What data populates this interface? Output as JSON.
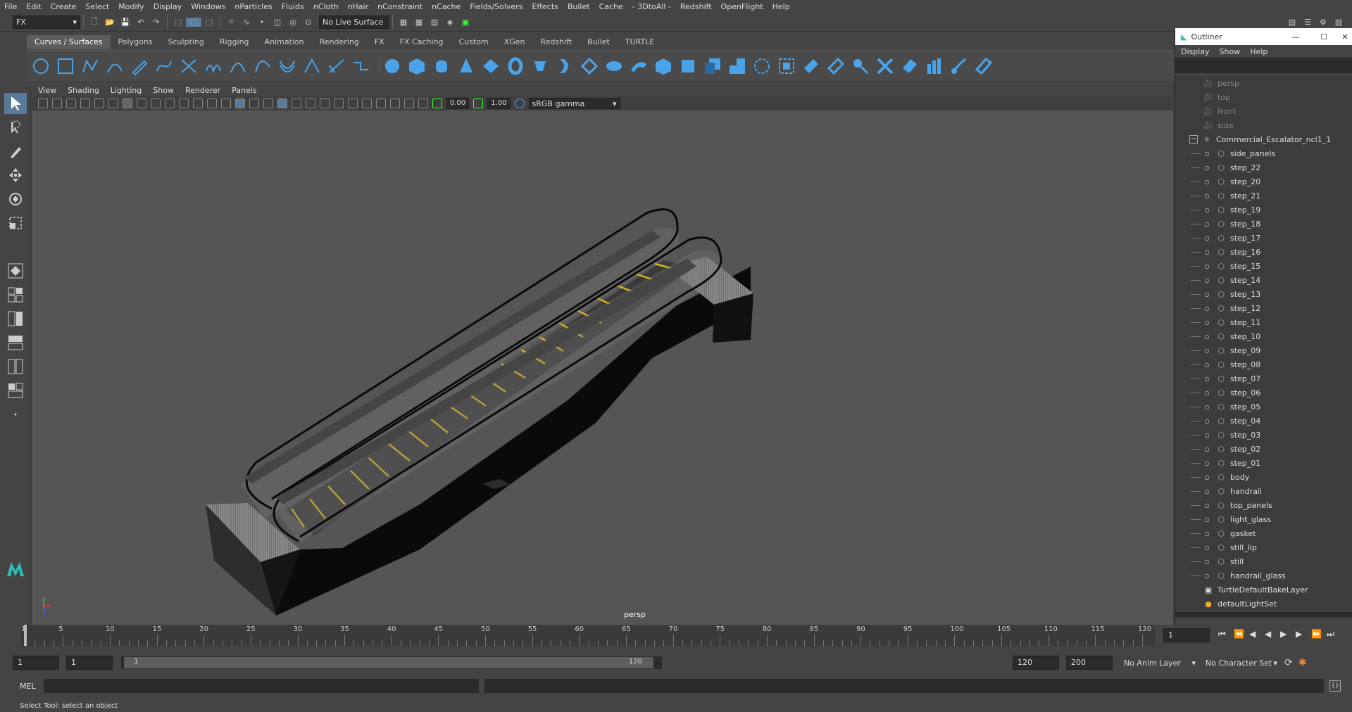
{
  "menubar": [
    "File",
    "Edit",
    "Create",
    "Select",
    "Modify",
    "Display",
    "Windows",
    "nParticles",
    "Fluids",
    "nCloth",
    "nHair",
    "nConstraint",
    "nCache",
    "Fields/Solvers",
    "Effects",
    "Bullet",
    "Cache",
    "- 3DtoAll -",
    "Redshift",
    "OpenFlight",
    "Help"
  ],
  "status": {
    "mode": "FX",
    "live_surface": "No Live Surface"
  },
  "shelf_tabs": [
    "Curves / Surfaces",
    "Polygons",
    "Sculpting",
    "Rigging",
    "Animation",
    "Rendering",
    "FX",
    "FX Caching",
    "Custom",
    "XGen",
    "Redshift",
    "Bullet",
    "TURTLE"
  ],
  "panel_menu": [
    "View",
    "Shading",
    "Lighting",
    "Show",
    "Renderer",
    "Panels"
  ],
  "panel_toolbar": {
    "exposure": "0.00",
    "gamma": "1.00",
    "color_space": "sRGB gamma"
  },
  "viewport": {
    "camera_label": "persp"
  },
  "outliner": {
    "title": "Outliner",
    "menu": [
      "Display",
      "Show",
      "Help"
    ],
    "cameras": [
      "persp",
      "top",
      "front",
      "side"
    ],
    "group": "Commercial_Escalator_ncl1_1",
    "children": [
      "side_panels",
      "step_22",
      "step_20",
      "step_21",
      "step_19",
      "step_18",
      "step_17",
      "step_16",
      "step_15",
      "step_14",
      "step_13",
      "step_12",
      "step_11",
      "step_10",
      "step_09",
      "step_08",
      "step_07",
      "step_06",
      "step_05",
      "step_04",
      "step_03",
      "step_02",
      "step_01",
      "body",
      "handrail",
      "top_panels",
      "light_glass",
      "gasket",
      "still_lip",
      "still",
      "handrail_glass"
    ],
    "extras": [
      "TurtleDefaultBakeLayer",
      "defaultLightSet"
    ]
  },
  "timeline": {
    "ticks": [
      "1",
      "5",
      "10",
      "15",
      "20",
      "25",
      "30",
      "35",
      "40",
      "45",
      "50",
      "55",
      "60",
      "65",
      "70",
      "75",
      "80",
      "85",
      "90",
      "95",
      "100",
      "105",
      "110",
      "115",
      "120"
    ],
    "current_frame": "1"
  },
  "range": {
    "start": "1",
    "playback_start": "1",
    "range_start": "1",
    "range_end": "120",
    "playback_end": "120",
    "end": "200",
    "anim_layer": "No Anim Layer",
    "char_set": "No Character Set"
  },
  "cmd": {
    "lang": "MEL"
  },
  "help": "Select Tool: select an object"
}
